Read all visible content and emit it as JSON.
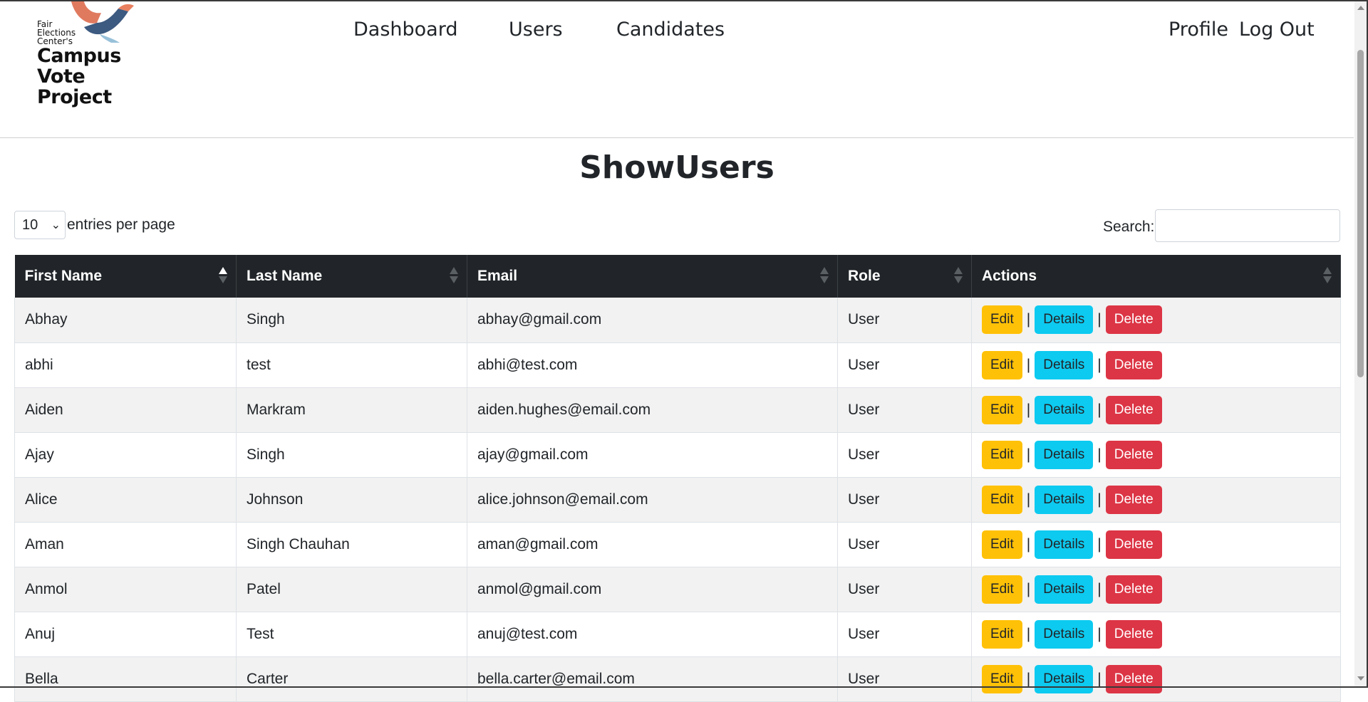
{
  "brand": {
    "line1": "Fair",
    "line2": "Elections",
    "line3": "Center's",
    "name1": "Campus",
    "name2": "Vote",
    "name3": "Project"
  },
  "nav": {
    "dashboard": "Dashboard",
    "users": "Users",
    "candidates": "Candidates",
    "profile": "Profile",
    "logout": "Log Out"
  },
  "page": {
    "title": "ShowUsers"
  },
  "controls": {
    "page_size": "10",
    "entries_label": "entries per page",
    "search_label": "Search:",
    "search_value": ""
  },
  "table": {
    "headers": [
      "First Name",
      "Last Name",
      "Email",
      "Role",
      "Actions"
    ],
    "rows": [
      {
        "first": "Abhay",
        "last": "Singh",
        "email": "abhay@gmail.com",
        "role": "User"
      },
      {
        "first": "abhi",
        "last": "test",
        "email": "abhi@test.com",
        "role": "User"
      },
      {
        "first": "Aiden",
        "last": "Markram",
        "email": "aiden.hughes@email.com",
        "role": "User"
      },
      {
        "first": "Ajay",
        "last": "Singh",
        "email": "ajay@gmail.com",
        "role": "User"
      },
      {
        "first": "Alice",
        "last": "Johnson",
        "email": "alice.johnson@email.com",
        "role": "User"
      },
      {
        "first": "Aman",
        "last": "Singh Chauhan",
        "email": "aman@gmail.com",
        "role": "User"
      },
      {
        "first": "Anmol",
        "last": "Patel",
        "email": "anmol@gmail.com",
        "role": "User"
      },
      {
        "first": "Anuj",
        "last": "Test",
        "email": "anuj@test.com",
        "role": "User"
      },
      {
        "first": "Bella",
        "last": "Carter",
        "email": "bella.carter@email.com",
        "role": "User"
      }
    ],
    "edit_label": "Edit",
    "details_label": "Details",
    "delete_label": "Delete",
    "separator": "|"
  },
  "colors": {
    "header_bg": "#212529",
    "edit": "#ffc107",
    "details": "#0dcaf0",
    "delete": "#dc3545",
    "stripe": "#f2f2f2"
  }
}
